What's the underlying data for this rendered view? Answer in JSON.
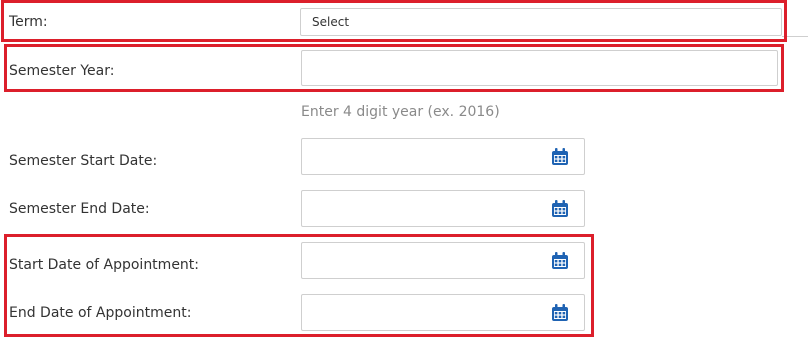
{
  "form": {
    "term": {
      "label": "Term:",
      "value": "Select"
    },
    "semester_year": {
      "label": "Semester Year:",
      "value": "",
      "hint": "Enter 4 digit year (ex. 2016)"
    },
    "semester_start_date": {
      "label": "Semester Start Date:",
      "value": ""
    },
    "semester_end_date": {
      "label": "Semester End Date:",
      "value": ""
    },
    "start_date_of_appointment": {
      "label": "Start Date of Appointment:",
      "value": ""
    },
    "end_date_of_appointment": {
      "label": "End Date of Appointment:",
      "value": ""
    }
  },
  "icons": {
    "date_picker": "calendar-icon"
  },
  "colors": {
    "highlight": "#dc1f2b",
    "calendar_icon": "#1f63b3",
    "hint": "#8a8a8a",
    "field_border": "#cfcfcf"
  }
}
